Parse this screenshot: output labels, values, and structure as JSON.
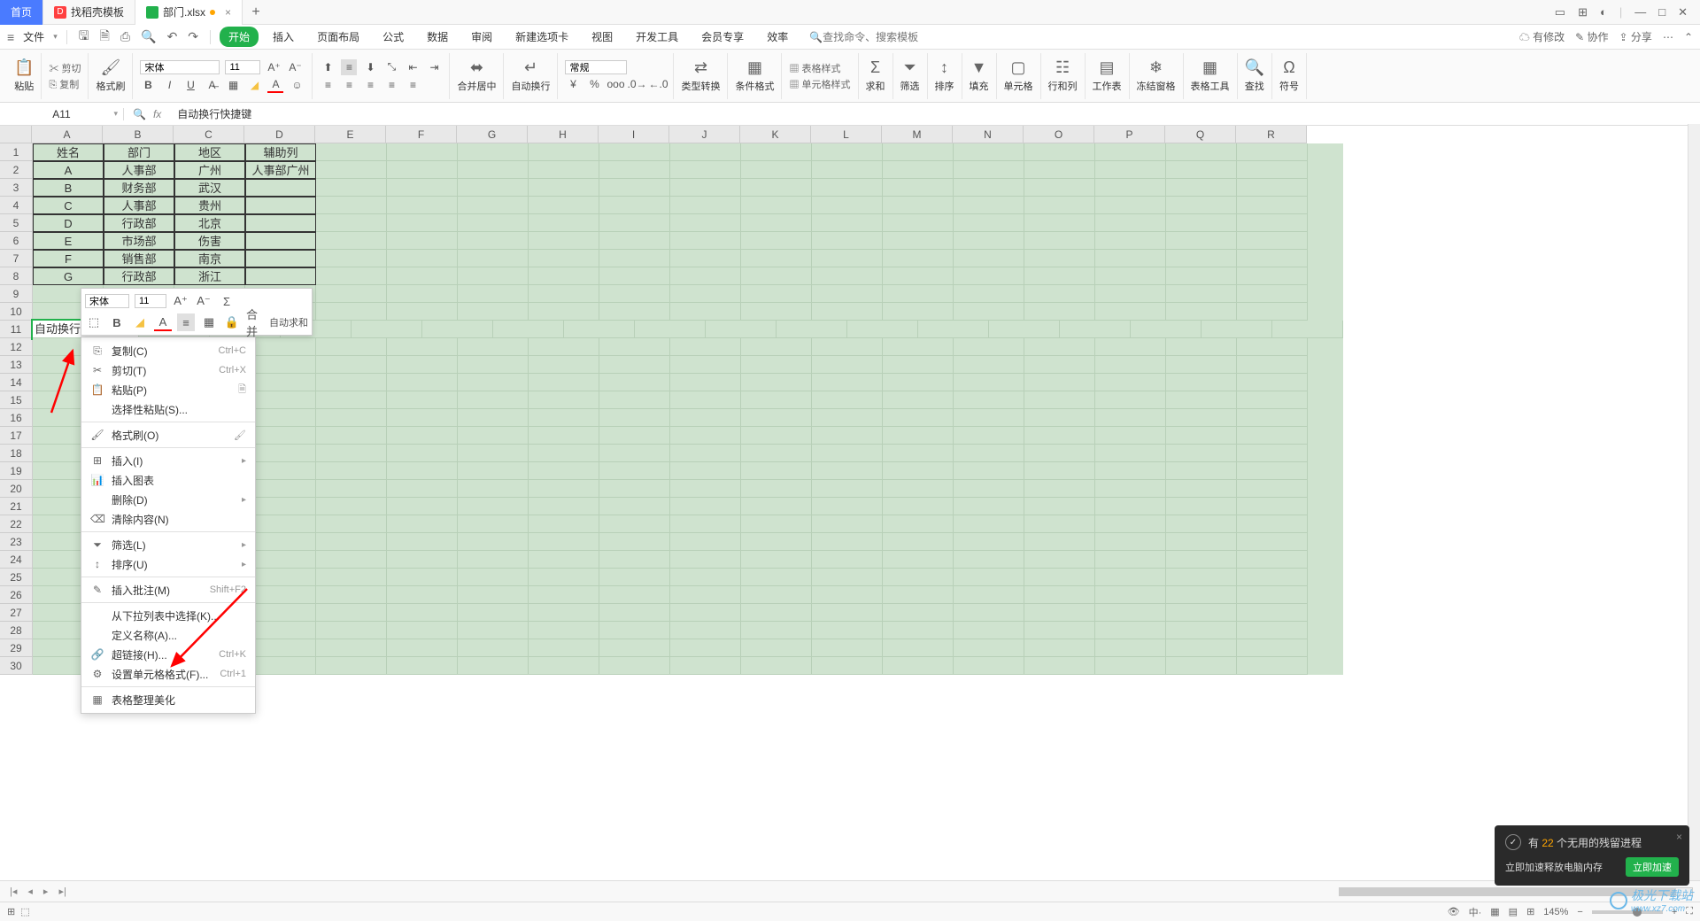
{
  "tabs": {
    "home": "首页",
    "t1": "找稻壳模板",
    "t2": "部门.xlsx"
  },
  "menubar": {
    "file": "文件",
    "tabs": [
      "开始",
      "插入",
      "页面布局",
      "公式",
      "数据",
      "审阅",
      "新建选项卡",
      "视图",
      "开发工具",
      "会员专享",
      "效率"
    ],
    "search_icon": "🔍",
    "search_ph": "查找命令、搜索模板",
    "right": {
      "cloud": "有修改",
      "collab": "协作",
      "share": "分享"
    }
  },
  "ribbon": {
    "paste": "粘贴",
    "cut": "剪切",
    "copy": "复制",
    "fmtpaint": "格式刷",
    "font": "宋体",
    "fontsize": "11",
    "mergecenter": "合并居中",
    "wrap": "自动换行",
    "numfmt": "常规",
    "typeconv": "类型转换",
    "condfmt": "条件格式",
    "tablestyle": "表格样式",
    "cellstyle": "单元格样式",
    "sum": "求和",
    "filter": "筛选",
    "sort": "排序",
    "fill": "填充",
    "cell": "单元格",
    "rowcol": "行和列",
    "sheet": "工作表",
    "freeze": "冻结窗格",
    "tabletool": "表格工具",
    "find": "查找",
    "symbol": "符号"
  },
  "namebox": "A11",
  "formula": "自动换行快捷键",
  "colheads": [
    "A",
    "B",
    "C",
    "D",
    "E",
    "F",
    "G",
    "H",
    "I",
    "J",
    "K",
    "L",
    "M",
    "N",
    "O",
    "P",
    "Q",
    "R"
  ],
  "rows": 30,
  "table": {
    "headers": [
      "姓名",
      "部门",
      "地区",
      "辅助列"
    ],
    "data": [
      [
        "A",
        "人事部",
        "广州",
        "人事部广州"
      ],
      [
        "B",
        "财务部",
        "武汉",
        ""
      ],
      [
        "C",
        "人事部",
        "贵州",
        ""
      ],
      [
        "D",
        "行政部",
        "北京",
        ""
      ],
      [
        "E",
        "市场部",
        "伤害",
        ""
      ],
      [
        "F",
        "销售部",
        "南京",
        ""
      ],
      [
        "G",
        "行政部",
        "浙江",
        ""
      ]
    ]
  },
  "a11": "自动换行快捷键",
  "minitb": {
    "font": "宋体",
    "size": "11",
    "merge": "合并",
    "autosum": "自动求和"
  },
  "ctx": {
    "copy": "复制(C)",
    "copy_sc": "Ctrl+C",
    "cut": "剪切(T)",
    "cut_sc": "Ctrl+X",
    "paste": "粘贴(P)",
    "pastesp": "选择性粘贴(S)...",
    "fmt": "格式刷(O)",
    "insert": "插入(I)",
    "chart": "插入图表",
    "delete": "删除(D)",
    "clear": "清除内容(N)",
    "filter": "筛选(L)",
    "sort": "排序(U)",
    "comment": "插入批注(M)",
    "comment_sc": "Shift+F2",
    "droplist": "从下拉列表中选择(K)...",
    "defname": "定义名称(A)...",
    "link": "超链接(H)...",
    "link_sc": "Ctrl+K",
    "cellfmt": "设置单元格格式(F)...",
    "cellfmt_sc": "Ctrl+1",
    "beautify": "表格整理美化"
  },
  "notif": {
    "title_pre": "有 ",
    "title_num": "22",
    "title_post": " 个无用的残留进程",
    "sub": "立即加速释放电脑内存",
    "btn": "立即加速"
  },
  "status": {
    "zoom": "145%"
  },
  "watermark": {
    "t1": "极光下载站",
    "t2": "www.xz7.com"
  }
}
